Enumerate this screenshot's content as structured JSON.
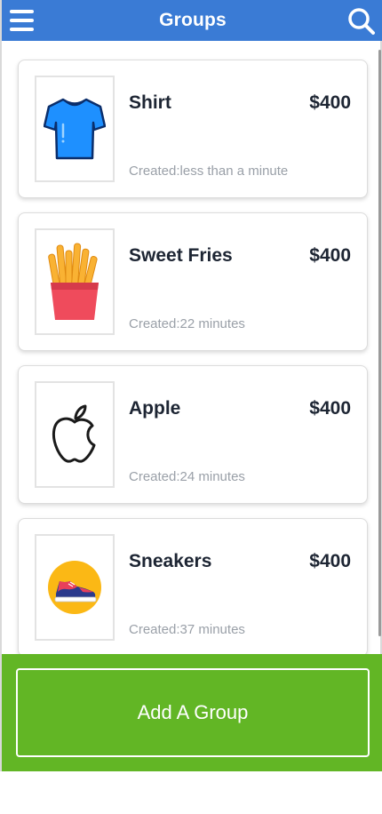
{
  "header": {
    "title": "Groups",
    "menu_icon": "hamburger-menu-icon",
    "search_icon": "search-icon",
    "background": "#3a7bd5"
  },
  "groups": [
    {
      "name": "Shirt",
      "price": "$400",
      "created": "Created:less than a minute",
      "icon": "shirt-icon"
    },
    {
      "name": "Sweet Fries",
      "price": "$400",
      "created": "Created:22 minutes",
      "icon": "fries-icon"
    },
    {
      "name": "Apple",
      "price": "$400",
      "created": "Created:24 minutes",
      "icon": "apple-logo-icon"
    },
    {
      "name": "Sneakers",
      "price": "$400",
      "created": "Created:37 minutes",
      "icon": "sneaker-icon"
    }
  ],
  "footer": {
    "add_label": "Add A Group",
    "background": "#62b625"
  }
}
